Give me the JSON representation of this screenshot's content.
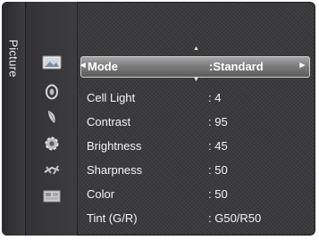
{
  "sidebar": {
    "tab_label": "Picture"
  },
  "icons": [
    "picture-icon",
    "sound-icon",
    "channel-icon",
    "setup-icon",
    "input-icon",
    "application-icon"
  ],
  "menu": {
    "items": [
      {
        "label": "Mode",
        "value": ":Standard",
        "selected": true
      },
      {
        "label": "Cell Light",
        "value": ": 4"
      },
      {
        "label": "Contrast",
        "value": ": 95"
      },
      {
        "label": "Brightness",
        "value": ": 45"
      },
      {
        "label": "Sharpness",
        "value": ": 50"
      },
      {
        "label": "Color",
        "value": ": 50"
      },
      {
        "label": "Tint (G/R)",
        "value": ": G50/R50"
      }
    ]
  },
  "colors": {
    "osd_background": "#3a3a3c",
    "highlight": "#8a8a8a",
    "text": "#f5f5f5"
  }
}
